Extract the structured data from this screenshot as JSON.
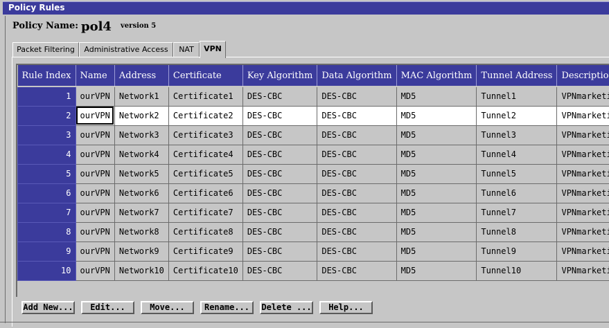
{
  "window": {
    "title": "Policy Rules"
  },
  "policy": {
    "name_label": "Policy Name:",
    "name_value": "pol4",
    "version": "version 5"
  },
  "tabs": [
    {
      "label": "Packet Filtering"
    },
    {
      "label": "Administrative Access"
    },
    {
      "label": "NAT"
    },
    {
      "label": "VPN"
    }
  ],
  "active_tab": "VPN",
  "table": {
    "columns": [
      "Rule Index",
      "Name",
      "Address",
      "Certificate",
      "Key Algorithm",
      "Data Algorithm",
      "MAC Algorithm",
      "Tunnel Address",
      "Description"
    ],
    "rows": [
      [
        "1",
        "ourVPN",
        "Network1",
        "Certificate1",
        "DES-CBC",
        "DES-CBC",
        "MD5",
        "Tunnel1",
        "VPNmarketing-"
      ],
      [
        "2",
        "ourVPN",
        "Network2",
        "Certificate2",
        "DES-CBC",
        "DES-CBC",
        "MD5",
        "Tunnel2",
        "VPNmarketing -"
      ],
      [
        "3",
        "ourVPN",
        "Network3",
        "Certificate3",
        "DES-CBC",
        "DES-CBC",
        "MD5",
        "Tunnel3",
        "VPNmarketing-"
      ],
      [
        "4",
        "ourVPN",
        "Network4",
        "Certificate4",
        "DES-CBC",
        "DES-CBC",
        "MD5",
        "Tunnel4",
        "VPNmarketing-"
      ],
      [
        "5",
        "ourVPN",
        "Network5",
        "Certificate5",
        "DES-CBC",
        "DES-CBC",
        "MD5",
        "Tunnel5",
        "VPNmarketing-"
      ],
      [
        "6",
        "ourVPN",
        "Network6",
        "Certificate6",
        "DES-CBC",
        "DES-CBC",
        "MD5",
        "Tunnel6",
        "VPNmarketing-"
      ],
      [
        "7",
        "ourVPN",
        "Network7",
        "Certificate7",
        "DES-CBC",
        "DES-CBC",
        "MD5",
        "Tunnel7",
        "VPNmarketing-"
      ],
      [
        "8",
        "ourVPN",
        "Network8",
        "Certificate8",
        "DES-CBC",
        "DES-CBC",
        "MD5",
        "Tunnel8",
        "VPNmarketing-"
      ],
      [
        "9",
        "ourVPN",
        "Network9",
        "Certificate9",
        "DES-CBC",
        "DES-CBC",
        "MD5",
        "Tunnel9",
        "VPNmarketing-"
      ],
      [
        "10",
        "ourVPN",
        "Network10",
        "Certificate10",
        "DES-CBC",
        "DES-CBC",
        "MD5",
        "Tunnel10",
        "VPNmarketing-"
      ]
    ],
    "selected_row": 2
  },
  "buttons": [
    {
      "label": "Add New..."
    },
    {
      "label": "Edit..."
    },
    {
      "label": "Move..."
    },
    {
      "label": "Rename..."
    },
    {
      "label": "Delete ..."
    },
    {
      "label": "Help..."
    }
  ],
  "colors": {
    "header_bg": "#3b3b9c",
    "panel_bg": "#c6c6c6",
    "selected_row_bg": "#ffffff"
  }
}
